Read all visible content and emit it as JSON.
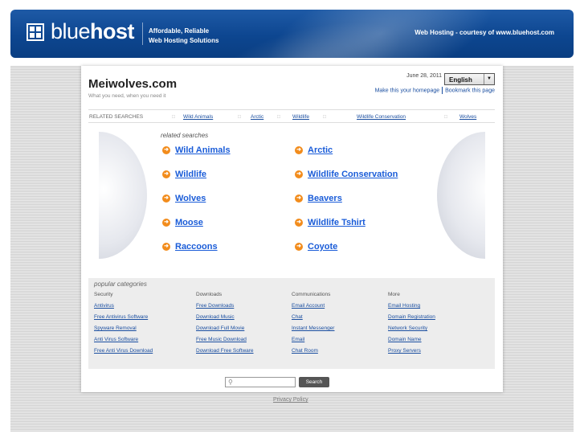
{
  "banner": {
    "logo_light": "blue",
    "logo_bold": "host",
    "tagline_1": "Affordable, Reliable",
    "tagline_2": "Web Hosting Solutions",
    "courtesy": "Web Hosting - courtesy of www.bluehost.com"
  },
  "header": {
    "site_title": "Meiwolves.com",
    "site_subtitle": "What you need, when you need it",
    "date": "June 28, 2011",
    "language": "English",
    "make_homepage": "Make this your homepage",
    "bookmark": "Bookmark this page"
  },
  "related_bar": {
    "label": "RELATED SEARCHES",
    "links": [
      "Wild Animals",
      "Arctic",
      "Wildlife",
      "Wildlife Conservation",
      "Wolves"
    ]
  },
  "related": {
    "heading": "related searches",
    "left": [
      "Wild Animals",
      "Wildlife",
      "Wolves",
      "Moose",
      "Raccoons"
    ],
    "right": [
      "Arctic",
      "Wildlife Conservation",
      "Beavers",
      "Wildlife Tshirt",
      "Coyote"
    ]
  },
  "popular": {
    "heading": "popular categories",
    "columns": [
      {
        "title": "Security",
        "links": [
          "Antivirus",
          "Free Antivirus Software",
          "Spyware Removal",
          "Anti Virus Software",
          "Free Anti Virus Download"
        ]
      },
      {
        "title": "Downloads",
        "links": [
          "Free Downloads",
          "Download Music",
          "Download Full Movie",
          "Free Music Download",
          "Download Free Software"
        ]
      },
      {
        "title": "Communications",
        "links": [
          "Email Account",
          "Chat",
          "Instant Messenger",
          "Email",
          "Chat Room"
        ]
      },
      {
        "title": "More",
        "links": [
          "Email Hosting",
          "Domain Registration",
          "Network Security",
          "Domain Name",
          "Proxy Servers"
        ]
      }
    ]
  },
  "search": {
    "value": "",
    "button": "Search"
  },
  "footer": {
    "privacy": "Privacy Policy"
  }
}
